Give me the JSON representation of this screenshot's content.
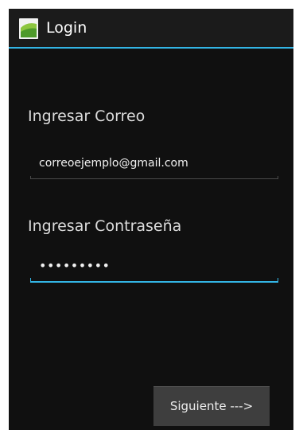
{
  "action_bar": {
    "title": "Login",
    "icon": "android-app-icon"
  },
  "form": {
    "email_label": "Ingresar Correo",
    "email_value": "correoejemplo@gmail.com",
    "password_label": "Ingresar Contraseña",
    "password_value": "•••••••••"
  },
  "buttons": {
    "next_label": "Siguiente --->"
  },
  "colors": {
    "accent": "#33b5e5",
    "background": "#101010",
    "button": "#3e3e3e"
  }
}
